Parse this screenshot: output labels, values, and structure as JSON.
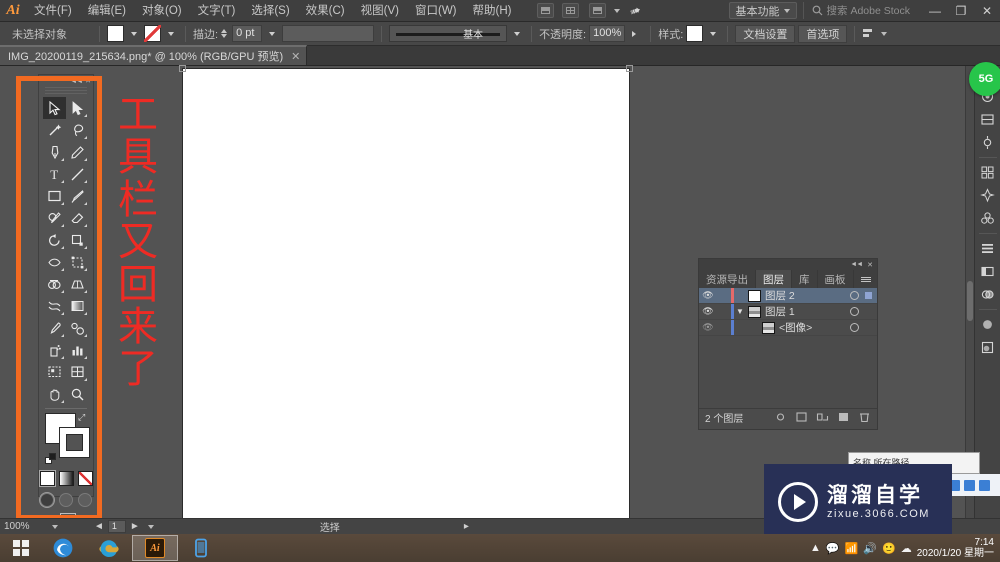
{
  "app": {
    "name": "Adobe Illustrator",
    "logo": "Ai"
  },
  "menubar": {
    "items": [
      {
        "label": "文件(F)"
      },
      {
        "label": "编辑(E)"
      },
      {
        "label": "对象(O)"
      },
      {
        "label": "文字(T)"
      },
      {
        "label": "选择(S)"
      },
      {
        "label": "效果(C)"
      },
      {
        "label": "视图(V)"
      },
      {
        "label": "窗口(W)"
      },
      {
        "label": "帮助(H)"
      }
    ],
    "workspace": "基本功能",
    "stock_search": "搜索 Adobe Stock",
    "minimize": "—",
    "restore": "❐",
    "close": "✕"
  },
  "controlbar": {
    "selection_status": "未选择对象",
    "stroke_label": "描边:",
    "stroke_weight": "0 pt",
    "profile_label": "基本",
    "opacity_label": "不透明度:",
    "opacity_value": "100%",
    "style_label": "样式:",
    "document_setup": "文档设置",
    "preferences": "首选项"
  },
  "tab": {
    "title": "IMG_20200119_215634.png* @ 100% (RGB/GPU 预览)",
    "close": "✕"
  },
  "toolbar": {
    "tools": [
      "selection-tool",
      "direct-selection-tool",
      "magic-wand-tool",
      "lasso-tool",
      "pen-tool",
      "curvature-tool",
      "type-tool",
      "line-segment-tool",
      "rectangle-tool",
      "paintbrush-tool",
      "shaper-tool",
      "eraser-tool",
      "rotate-tool",
      "scale-tool",
      "width-tool",
      "free-transform-tool",
      "shape-builder-tool",
      "perspective-grid-tool",
      "mesh-tool",
      "gradient-tool",
      "eyedropper-tool",
      "blend-tool",
      "symbol-sprayer-tool",
      "column-graph-tool",
      "artboard-tool",
      "slice-tool",
      "hand-tool",
      "zoom-tool"
    ],
    "fill_color": "#ffffff",
    "stroke_color": "#ffffff",
    "modes": [
      "color-mode",
      "gradient-mode",
      "none-mode"
    ],
    "draw_modes": [
      "draw-normal",
      "draw-behind",
      "draw-inside"
    ],
    "screen_mode": "change-screen-mode"
  },
  "annotation": {
    "text": "工具栏又回来了",
    "box_color": "#f26a21",
    "text_color": "#ee2b24"
  },
  "layers_panel": {
    "tabs": [
      {
        "label": "资源导出",
        "active": false
      },
      {
        "label": "图层",
        "active": true
      },
      {
        "label": "库",
        "active": false
      },
      {
        "label": "画板",
        "active": false
      }
    ],
    "rows": [
      {
        "name": "图层 2",
        "selected": true,
        "visible": true,
        "expandable": false,
        "indent": 0,
        "thumb": "blank"
      },
      {
        "name": "图层 1",
        "selected": false,
        "visible": true,
        "expandable": true,
        "indent": 0,
        "thumb": "image"
      },
      {
        "name": "<图像>",
        "selected": false,
        "visible": true,
        "expandable": false,
        "indent": 1,
        "thumb": "image"
      }
    ],
    "footer_count": "2 个图层",
    "footer_icons": [
      "locate-object",
      "make-clipping-mask",
      "create-new-sublayer",
      "create-new-layer",
      "delete-selection"
    ]
  },
  "right_dock": {
    "icons": [
      "color-panel",
      "color-guide-panel",
      "properties-panel",
      "swatches-panel",
      "brushes-panel",
      "symbols-panel",
      "align-panel",
      "transform-panel",
      "pathfinder-panel",
      "appearance-panel",
      "graphic-styles-panel"
    ],
    "badge": "5G"
  },
  "statusbar": {
    "zoom": "100%",
    "artboard_number": "1",
    "current_tool": "选择"
  },
  "taskbar": {
    "start": "start-button",
    "apps": [
      {
        "name": "edge-browser",
        "active": false
      },
      {
        "name": "internet-explorer",
        "active": false
      },
      {
        "name": "adobe-illustrator",
        "active": true,
        "label": "Ai"
      },
      {
        "name": "phone-companion",
        "active": false
      }
    ],
    "clock_time": "7:14",
    "clock_date": "2020/1/20 星期一"
  },
  "watermark": {
    "title": "溜溜自学",
    "url": "zixue.3066.COM"
  },
  "popup": {
    "text": "名称         所在路径"
  }
}
